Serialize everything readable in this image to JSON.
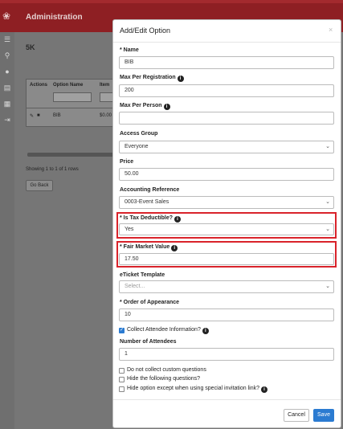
{
  "app": {
    "title": "Administration",
    "section": "5K",
    "sidebar_icons": [
      "menu-icon",
      "search-icon",
      "user-icon",
      "list-icon",
      "grid-icon",
      "logout-icon"
    ]
  },
  "table": {
    "headers": [
      "Actions",
      "Option Name",
      "Item"
    ],
    "rows": [
      {
        "name": "BIB",
        "item": "$0.00"
      }
    ],
    "showing": "Showing 1 to 1 of 1 rows",
    "go_back": "Go Back"
  },
  "modal": {
    "title": "Add/Edit Option",
    "close": "×",
    "fields": {
      "name": {
        "label": "* Name",
        "value": "BIB"
      },
      "max_per_registration": {
        "label": "Max Per Registration",
        "value": "200"
      },
      "max_per_person": {
        "label": "Max Per Person",
        "value": ""
      },
      "access_group": {
        "label": "Access Group",
        "value": "Everyone"
      },
      "price": {
        "label": "Price",
        "value": "50.00"
      },
      "accounting_reference": {
        "label": "Accounting Reference",
        "value": "0003-Event Sales"
      },
      "is_tax_deductible": {
        "label": "* Is Tax Deductible?",
        "value": "Yes"
      },
      "fair_market_value": {
        "label": "* Fair Market Value",
        "value": "17.50"
      },
      "eticket_template": {
        "label": "eTicket Template",
        "placeholder": "Select..."
      },
      "order_of_appearance": {
        "label": "* Order of Appearance",
        "value": "10"
      },
      "collect_attendee_info": {
        "label": "Collect Attendee Information?",
        "checked": true
      },
      "number_of_attendees": {
        "label": "Number of Attendees",
        "value": "1"
      },
      "do_not_collect_custom": {
        "label": "Do not collect custom questions",
        "checked": false
      },
      "hide_following": {
        "label": "Hide the following questions?",
        "checked": false
      },
      "hide_option_except": {
        "label": "Hide option except when using special invitation link?",
        "checked": false
      }
    },
    "buttons": {
      "cancel": "Cancel",
      "save": "Save"
    },
    "info_glyph": "i"
  },
  "colors": {
    "brand": "#8e1f23",
    "highlight": "#d9232b",
    "primary": "#2b7bd1"
  }
}
